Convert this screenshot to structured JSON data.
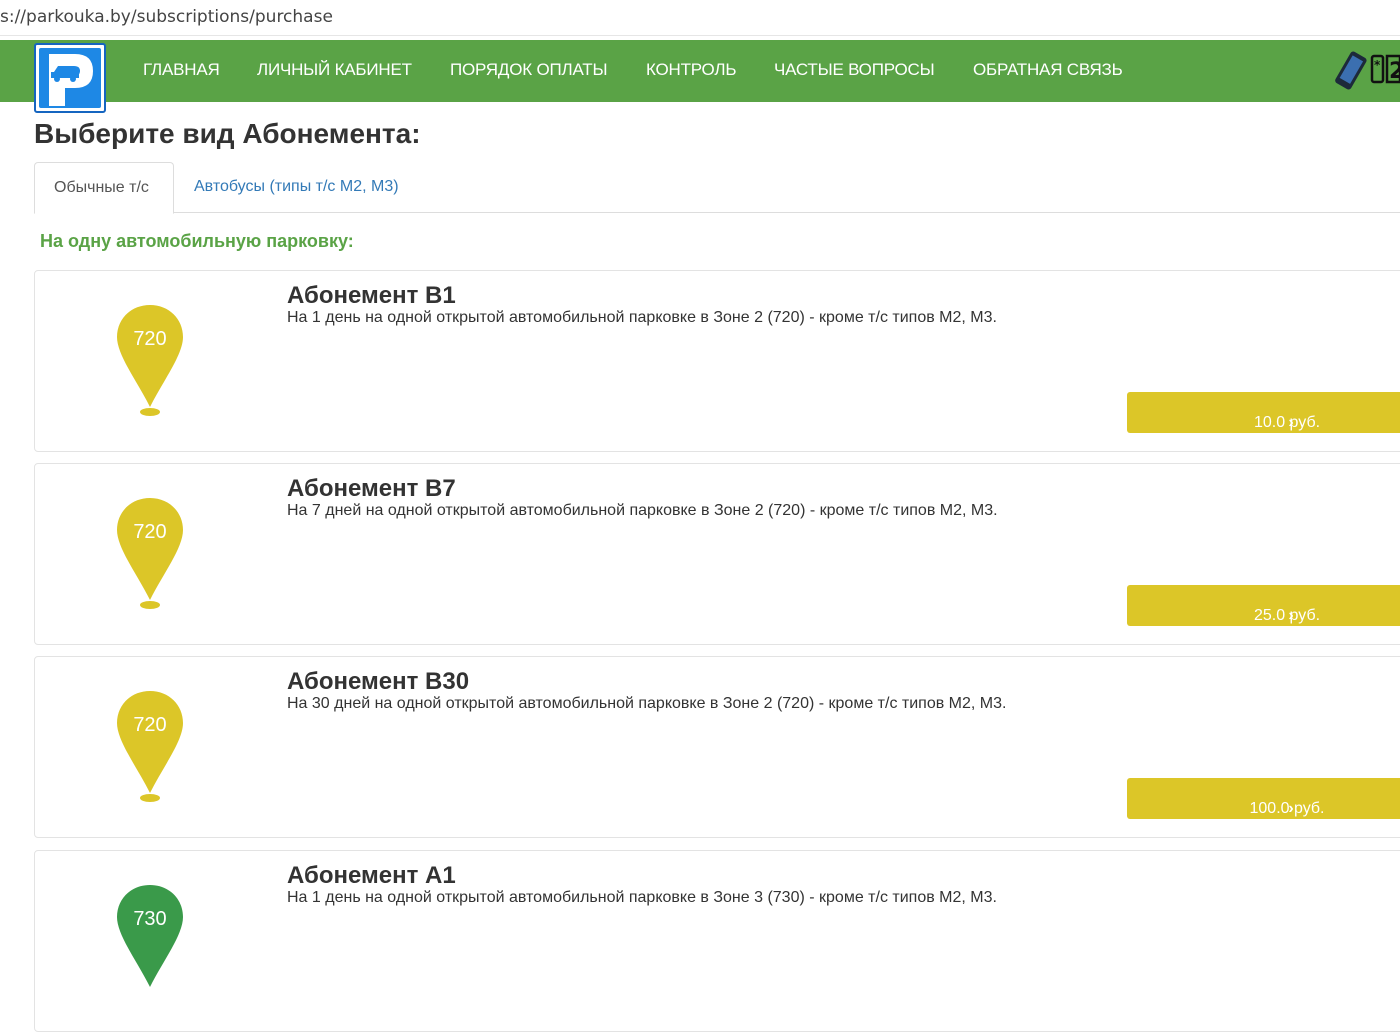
{
  "browser": {
    "url": "s://parkouka.by/subscriptions/purchase"
  },
  "nav": {
    "items": [
      "ГЛАВНАЯ",
      "ЛИЧНЫЙ КАБИНЕТ",
      "ПОРЯДОК ОПЛАТЫ",
      "КОНТРОЛЬ",
      "ЧАСТЫЕ ВОПРОСЫ",
      "ОБРАТНАЯ СВЯЗЬ"
    ]
  },
  "page": {
    "title": "Выберите вид Абонемента:",
    "tabs": [
      "Обычные т/с",
      "Автобусы (типы т/с М2, М3)"
    ],
    "section_heading": "На одну автомобильную парковку:"
  },
  "subscriptions": [
    {
      "title": "Абонемент В1",
      "description": "На 1 день на одной открытой автомобильной парковке в Зоне 2 (720) - кроме т/с типов М2, М3.",
      "zone": "720",
      "pin_color": "#dcc628",
      "price": "10.0 руб."
    },
    {
      "title": "Абонемент В7",
      "description": "На 7 дней на одной открытой автомобильной парковке в Зоне 2 (720) - кроме т/с типов М2, М3.",
      "zone": "720",
      "pin_color": "#dcc628",
      "price": "25.0 руб."
    },
    {
      "title": "Абонемент В30",
      "description": "На 30 дней на одной открытой автомобильной парковке в Зоне 2 (720) - кроме т/с типов М2, М3.",
      "zone": "720",
      "pin_color": "#dcc628",
      "price": "100.0 руб."
    },
    {
      "title": "Абонемент А1",
      "description": "На 1 день на одной открытой автомобильной парковке в Зоне 3 (730) - кроме т/с типов М2, М3.",
      "zone": "730",
      "pin_color": "#3a9a4a",
      "price": ""
    }
  ],
  "colors": {
    "nav_bg": "#5aa346",
    "logo_blue": "#1e88e5",
    "price_button": "#dcc628",
    "link": "#337ab7"
  },
  "icons": {
    "logo": "parking-logo-icon",
    "phone": "phone-icon",
    "pin": "map-pin-icon",
    "chevron": "chevron-right-icon"
  }
}
